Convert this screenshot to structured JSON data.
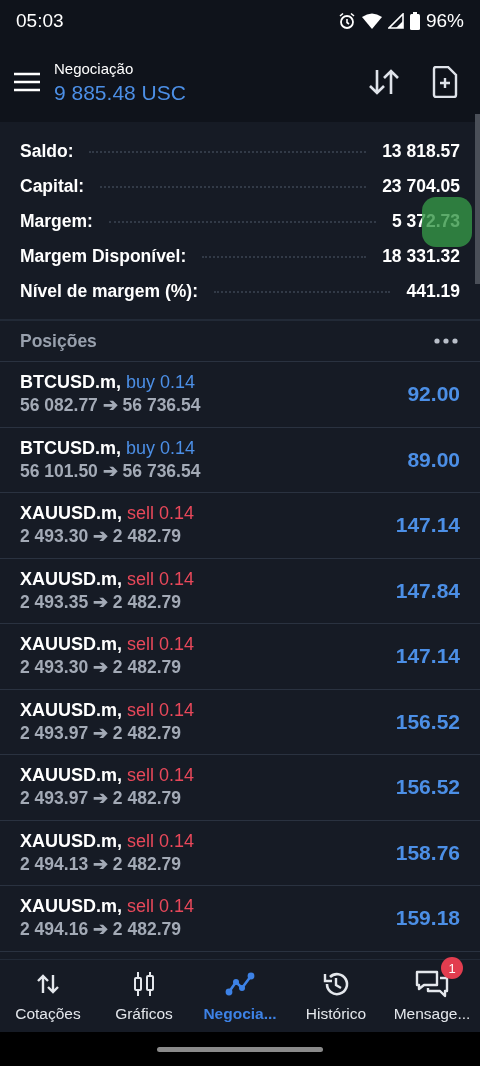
{
  "status_bar": {
    "time": "05:03",
    "battery": "96%"
  },
  "header": {
    "title": "Negociação",
    "balance": "9 885.48 USC"
  },
  "summary": [
    {
      "label": "Saldo:",
      "value": "13 818.57"
    },
    {
      "label": "Capital:",
      "value": "23 704.05"
    },
    {
      "label": "Margem:",
      "value": "5 372.73"
    },
    {
      "label": "Margem Disponível:",
      "value": "18 331.32"
    },
    {
      "label": "Nível de margem (%):",
      "value": "441.19"
    }
  ],
  "positions_title": "Posições",
  "positions": [
    {
      "symbol": "BTCUSD.m,",
      "side": "buy",
      "volume": "0.14",
      "prices": "56 082.77 ➔ 56 736.54",
      "profit": "92.00"
    },
    {
      "symbol": "BTCUSD.m,",
      "side": "buy",
      "volume": "0.14",
      "prices": "56 101.50 ➔ 56 736.54",
      "profit": "89.00"
    },
    {
      "symbol": "XAUUSD.m,",
      "side": "sell",
      "volume": "0.14",
      "prices": "2 493.30 ➔ 2 482.79",
      "profit": "147.14"
    },
    {
      "symbol": "XAUUSD.m,",
      "side": "sell",
      "volume": "0.14",
      "prices": "2 493.35 ➔ 2 482.79",
      "profit": "147.84"
    },
    {
      "symbol": "XAUUSD.m,",
      "side": "sell",
      "volume": "0.14",
      "prices": "2 493.30 ➔ 2 482.79",
      "profit": "147.14"
    },
    {
      "symbol": "XAUUSD.m,",
      "side": "sell",
      "volume": "0.14",
      "prices": "2 493.97 ➔ 2 482.79",
      "profit": "156.52"
    },
    {
      "symbol": "XAUUSD.m,",
      "side": "sell",
      "volume": "0.14",
      "prices": "2 493.97 ➔ 2 482.79",
      "profit": "156.52"
    },
    {
      "symbol": "XAUUSD.m,",
      "side": "sell",
      "volume": "0.14",
      "prices": "2 494.13 ➔ 2 482.79",
      "profit": "158.76"
    },
    {
      "symbol": "XAUUSD.m,",
      "side": "sell",
      "volume": "0.14",
      "prices": "2 494.16 ➔ 2 482.79",
      "profit": "159.18"
    }
  ],
  "nav": [
    {
      "kind": "quotes",
      "label": "Cotações",
      "selected": false
    },
    {
      "kind": "charts",
      "label": "Gráficos",
      "selected": false
    },
    {
      "kind": "trade",
      "label": "Negocia...",
      "selected": true
    },
    {
      "kind": "history",
      "label": "Histórico",
      "selected": false
    },
    {
      "kind": "messages",
      "label": "Mensage...",
      "selected": false,
      "badge": "1"
    }
  ]
}
